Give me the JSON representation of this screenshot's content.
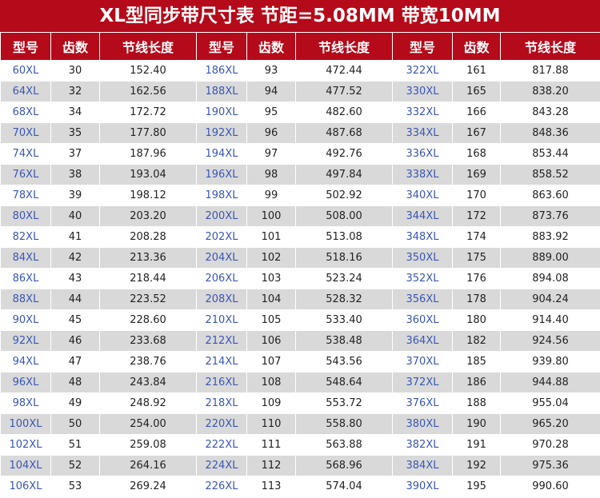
{
  "title": "XL型同步带尺寸表 节距=5.08MM 带宽10MM",
  "headers": [
    "型号",
    "齿数",
    "节线长度",
    "型号",
    "齿数",
    "节线长度",
    "型号",
    "齿数",
    "节线长度"
  ],
  "colors": {
    "header_bg": "#b50a1a",
    "model_text": "#3a56b5",
    "row_alt_bg": "#d9d9d9"
  },
  "rows": [
    [
      "60XL",
      "30",
      "152.40",
      "186XL",
      "93",
      "472.44",
      "322XL",
      "161",
      "817.88"
    ],
    [
      "64XL",
      "32",
      "162.56",
      "188XL",
      "94",
      "477.52",
      "330XL",
      "165",
      "838.20"
    ],
    [
      "68XL",
      "34",
      "172.72",
      "190XL",
      "95",
      "482.60",
      "332XL",
      "166",
      "843.28"
    ],
    [
      "70XL",
      "35",
      "177.80",
      "192XL",
      "96",
      "487.68",
      "334XL",
      "167",
      "848.36"
    ],
    [
      "74XL",
      "37",
      "187.96",
      "194XL",
      "97",
      "492.76",
      "336XL",
      "168",
      "853.44"
    ],
    [
      "76XL",
      "38",
      "193.04",
      "196XL",
      "98",
      "497.84",
      "338XL",
      "169",
      "858.52"
    ],
    [
      "78XL",
      "39",
      "198.12",
      "198XL",
      "99",
      "502.92",
      "340XL",
      "170",
      "863.60"
    ],
    [
      "80XL",
      "40",
      "203.20",
      "200XL",
      "100",
      "508.00",
      "344XL",
      "172",
      "873.76"
    ],
    [
      "82XL",
      "41",
      "208.28",
      "202XL",
      "101",
      "513.08",
      "348XL",
      "174",
      "883.92"
    ],
    [
      "84XL",
      "42",
      "213.36",
      "204XL",
      "102",
      "518.16",
      "350XL",
      "175",
      "889.00"
    ],
    [
      "86XL",
      "43",
      "218.44",
      "206XL",
      "103",
      "523.24",
      "352XL",
      "176",
      "894.08"
    ],
    [
      "88XL",
      "44",
      "223.52",
      "208XL",
      "104",
      "528.32",
      "356XL",
      "178",
      "904.24"
    ],
    [
      "90XL",
      "45",
      "228.60",
      "210XL",
      "105",
      "533.40",
      "360XL",
      "180",
      "914.40"
    ],
    [
      "92XL",
      "46",
      "233.68",
      "212XL",
      "106",
      "538.48",
      "364XL",
      "182",
      "924.56"
    ],
    [
      "94XL",
      "47",
      "238.76",
      "214XL",
      "107",
      "543.56",
      "370XL",
      "185",
      "939.80"
    ],
    [
      "96XL",
      "48",
      "243.84",
      "216XL",
      "108",
      "548.64",
      "372XL",
      "186",
      "944.88"
    ],
    [
      "98XL",
      "49",
      "248.92",
      "218XL",
      "109",
      "553.72",
      "376XL",
      "188",
      "955.04"
    ],
    [
      "100XL",
      "50",
      "254.00",
      "220XL",
      "110",
      "558.80",
      "380XL",
      "190",
      "965.20"
    ],
    [
      "102XL",
      "51",
      "259.08",
      "222XL",
      "111",
      "563.88",
      "382XL",
      "191",
      "970.28"
    ],
    [
      "104XL",
      "52",
      "264.16",
      "224XL",
      "112",
      "568.96",
      "384XL",
      "192",
      "975.36"
    ],
    [
      "106XL",
      "53",
      "269.24",
      "226XL",
      "113",
      "574.04",
      "390XL",
      "195",
      "990.60"
    ]
  ]
}
